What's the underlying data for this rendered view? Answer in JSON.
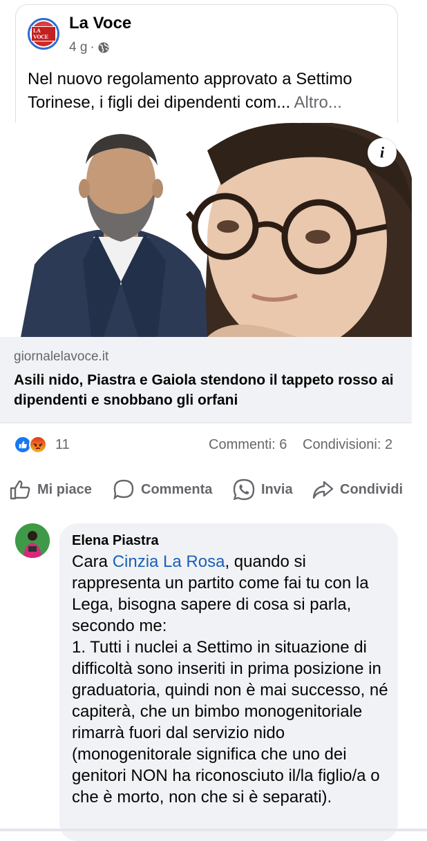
{
  "post": {
    "page_name": "La Voce",
    "logo_text": "LA VOCE",
    "time": "4 g",
    "separator": "·",
    "text": "Nel nuovo regolamento approvato a Settimo Torinese, i figli dei dipendenti com...",
    "more_label": "Altro..."
  },
  "link": {
    "domain": "giornalelavoce.it",
    "headline": "Asili nido, Piastra e Gaiola stendono il tappeto rosso ai dipendenti e snobbano gli orfani",
    "info_label": "i"
  },
  "stats": {
    "reactions": "11",
    "comments": "Commenti: 6",
    "shares": "Condivisioni: 2"
  },
  "actions": {
    "like": "Mi piace",
    "comment": "Commenta",
    "send": "Invia",
    "share": "Condividi"
  },
  "comment": {
    "author": "Elena Piastra",
    "prefix": "Cara ",
    "mention": "Cinzia La Rosa",
    "body": ", quando si rappresenta un partito come fai tu con la Lega, bisogna sapere di cosa si parla, secondo me:",
    "point1": "1. Tutti i nuclei a Settimo in situazione di difficoltà sono inseriti in prima posizione in graduatoria, quindi non è mai successo, né capiterà, che un bimbo monogenitoriale rimarrà fuori dal servizio nido (monogenitorale significa che uno dei genitori NON ha riconosciuto il/la figlio/a o che è morto, non che si è separati)."
  },
  "colors": {
    "brand": "#1877f2",
    "link": "#1b5fb8",
    "muted": "#65676b",
    "bubble": "#f0f2f5"
  }
}
